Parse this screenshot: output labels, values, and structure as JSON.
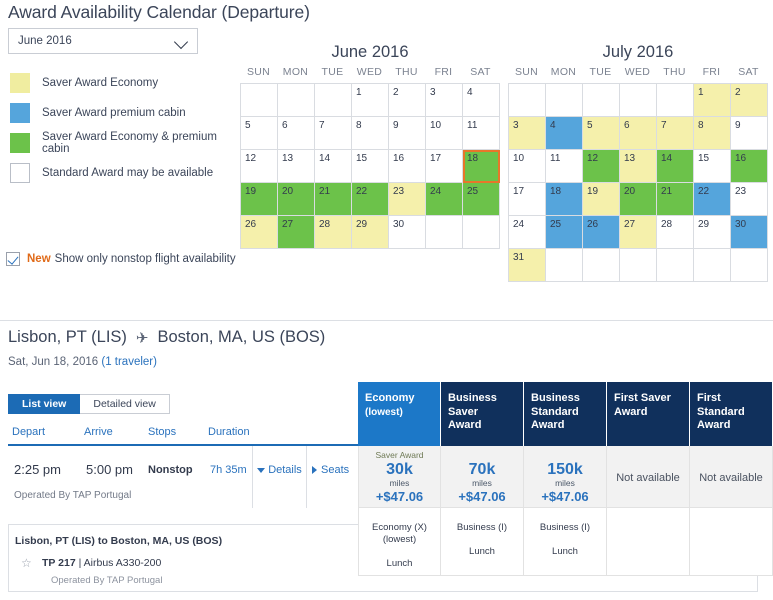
{
  "title": "Award Availability Calendar (Departure)",
  "month_select": {
    "value": "June 2016",
    "icon": "chevron-down-icon"
  },
  "legend": [
    {
      "color": "#f0eda0",
      "label": "Saver Award Economy"
    },
    {
      "color": "#55a5dc",
      "label": "Saver Award premium cabin"
    },
    {
      "color": "#6cc24a",
      "label": "Saver Award Economy & premium cabin"
    },
    {
      "color": "#ffffff",
      "label": "Standard Award may be available"
    }
  ],
  "nonstop": {
    "checked": true,
    "new_tag": "New",
    "label": "Show only nonstop flight availability"
  },
  "calendars": [
    {
      "title": "June 2016",
      "dow": [
        "SUN",
        "MON",
        "TUE",
        "WED",
        "THU",
        "FRI",
        "SAT"
      ],
      "weeks": [
        [
          {
            "d": "",
            "s": "empty"
          },
          {
            "d": "",
            "s": "empty"
          },
          {
            "d": "",
            "s": "empty"
          },
          {
            "d": "1",
            "s": "white"
          },
          {
            "d": "2",
            "s": "white"
          },
          {
            "d": "3",
            "s": "white"
          },
          {
            "d": "4",
            "s": "white"
          }
        ],
        [
          {
            "d": "5",
            "s": "white"
          },
          {
            "d": "6",
            "s": "white"
          },
          {
            "d": "7",
            "s": "white"
          },
          {
            "d": "8",
            "s": "white"
          },
          {
            "d": "9",
            "s": "white"
          },
          {
            "d": "10",
            "s": "white"
          },
          {
            "d": "11",
            "s": "white"
          }
        ],
        [
          {
            "d": "12",
            "s": "white"
          },
          {
            "d": "13",
            "s": "white"
          },
          {
            "d": "14",
            "s": "white"
          },
          {
            "d": "15",
            "s": "white"
          },
          {
            "d": "16",
            "s": "white"
          },
          {
            "d": "17",
            "s": "white"
          },
          {
            "d": "18",
            "s": "green",
            "selected": true
          }
        ],
        [
          {
            "d": "19",
            "s": "green"
          },
          {
            "d": "20",
            "s": "green"
          },
          {
            "d": "21",
            "s": "green"
          },
          {
            "d": "22",
            "s": "green"
          },
          {
            "d": "23",
            "s": "yellow"
          },
          {
            "d": "24",
            "s": "green"
          },
          {
            "d": "25",
            "s": "green"
          }
        ],
        [
          {
            "d": "26",
            "s": "yellow"
          },
          {
            "d": "27",
            "s": "green"
          },
          {
            "d": "28",
            "s": "yellow"
          },
          {
            "d": "29",
            "s": "yellow"
          },
          {
            "d": "30",
            "s": "white"
          },
          {
            "d": "",
            "s": "empty"
          },
          {
            "d": "",
            "s": "empty"
          }
        ]
      ]
    },
    {
      "title": "July 2016",
      "dow": [
        "SUN",
        "MON",
        "TUE",
        "WED",
        "THU",
        "FRI",
        "SAT"
      ],
      "weeks": [
        [
          {
            "d": "",
            "s": "empty"
          },
          {
            "d": "",
            "s": "empty"
          },
          {
            "d": "",
            "s": "empty"
          },
          {
            "d": "",
            "s": "empty"
          },
          {
            "d": "",
            "s": "empty"
          },
          {
            "d": "1",
            "s": "yellow"
          },
          {
            "d": "2",
            "s": "yellow"
          }
        ],
        [
          {
            "d": "3",
            "s": "yellow"
          },
          {
            "d": "4",
            "s": "blue"
          },
          {
            "d": "5",
            "s": "yellow"
          },
          {
            "d": "6",
            "s": "yellow"
          },
          {
            "d": "7",
            "s": "yellow"
          },
          {
            "d": "8",
            "s": "yellow"
          },
          {
            "d": "9",
            "s": "white"
          }
        ],
        [
          {
            "d": "10",
            "s": "white"
          },
          {
            "d": "11",
            "s": "white"
          },
          {
            "d": "12",
            "s": "green"
          },
          {
            "d": "13",
            "s": "yellow"
          },
          {
            "d": "14",
            "s": "green"
          },
          {
            "d": "15",
            "s": "white"
          },
          {
            "d": "16",
            "s": "green"
          }
        ],
        [
          {
            "d": "17",
            "s": "white"
          },
          {
            "d": "18",
            "s": "blue"
          },
          {
            "d": "19",
            "s": "yellow"
          },
          {
            "d": "20",
            "s": "green"
          },
          {
            "d": "21",
            "s": "green"
          },
          {
            "d": "22",
            "s": "blue"
          },
          {
            "d": "23",
            "s": "white"
          }
        ],
        [
          {
            "d": "24",
            "s": "white"
          },
          {
            "d": "25",
            "s": "blue"
          },
          {
            "d": "26",
            "s": "blue"
          },
          {
            "d": "27",
            "s": "yellow"
          },
          {
            "d": "28",
            "s": "white"
          },
          {
            "d": "29",
            "s": "white"
          },
          {
            "d": "30",
            "s": "blue"
          }
        ],
        [
          {
            "d": "31",
            "s": "yellow"
          },
          {
            "d": "",
            "s": "empty"
          },
          {
            "d": "",
            "s": "empty"
          },
          {
            "d": "",
            "s": "empty"
          },
          {
            "d": "",
            "s": "empty"
          },
          {
            "d": "",
            "s": "empty"
          },
          {
            "d": "",
            "s": "empty"
          }
        ]
      ]
    }
  ],
  "next_month_icon": "chevron-right-icon",
  "route": {
    "origin": "Lisbon, PT (LIS)",
    "plane_icon": "airplane-icon",
    "destination": "Boston, MA, US (BOS)",
    "date": "Sat, Jun 18, 2016 ",
    "travelers": "(1 traveler)"
  },
  "view_toggle": {
    "list": "List view",
    "detailed": "Detailed view",
    "active": "list"
  },
  "columns": {
    "depart": "Depart",
    "arrive": "Arrive",
    "stops": "Stops",
    "duration": "Duration"
  },
  "flight": {
    "depart": "2:25 pm",
    "arrive": "5:00 pm",
    "stops": "Nonstop",
    "duration": "7h 35m",
    "operated_by": "Operated By TAP Portugal",
    "details_label": "Details",
    "seats_label": "Seats"
  },
  "details_panel": {
    "title": "Lisbon, PT (LIS) to Boston, MA, US (BOS)",
    "flight_number": "TP 217",
    "separator": " | ",
    "aircraft": "Airbus A330-200",
    "operated_by": "Operated By TAP Portugal",
    "star_icon": "star-icon"
  },
  "fares": [
    {
      "head_line1": "Economy",
      "head_line2": "(lowest)",
      "highlight": true,
      "saver_label": "Saver Award",
      "miles": "30k",
      "miles_unit": "miles",
      "price": "+$47.06",
      "available": true,
      "detail_line1": "Economy (X)",
      "detail_line2": "(lowest)",
      "meal": "Lunch"
    },
    {
      "head_line1": "Business",
      "head_line2": "Saver",
      "head_line3": "Award",
      "highlight": false,
      "saver_label": "",
      "miles": "70k",
      "miles_unit": "miles",
      "price": "+$47.06",
      "available": true,
      "detail_line1": "Business (I)",
      "detail_line2": "",
      "meal": "Lunch"
    },
    {
      "head_line1": "Business",
      "head_line2": "Standard",
      "head_line3": "Award",
      "highlight": false,
      "saver_label": "",
      "miles": "150k",
      "miles_unit": "miles",
      "price": "+$47.06",
      "available": true,
      "detail_line1": "Business (I)",
      "detail_line2": "",
      "meal": "Lunch"
    },
    {
      "head_line1": "First Saver",
      "head_line2": "Award",
      "highlight": false,
      "available": false,
      "not_available": "Not available",
      "detail_line1": "",
      "detail_line2": "",
      "meal": ""
    },
    {
      "head_line1": "First",
      "head_line2": "Standard",
      "head_line3": "Award",
      "highlight": false,
      "available": false,
      "not_available": "Not available",
      "detail_line1": "",
      "detail_line2": "",
      "meal": ""
    }
  ],
  "colors": {
    "saver_economy": "#f0eda0",
    "saver_premium": "#55a5dc",
    "saver_both": "#6cc24a",
    "standard": "#ffffff",
    "selected_outline": "#e8762a",
    "brand_blue": "#1c6bb5",
    "header_navy": "#10305c",
    "economy_blue": "#1c78c8",
    "link_blue": "#2a72bd",
    "new_orange": "#e06a18"
  }
}
